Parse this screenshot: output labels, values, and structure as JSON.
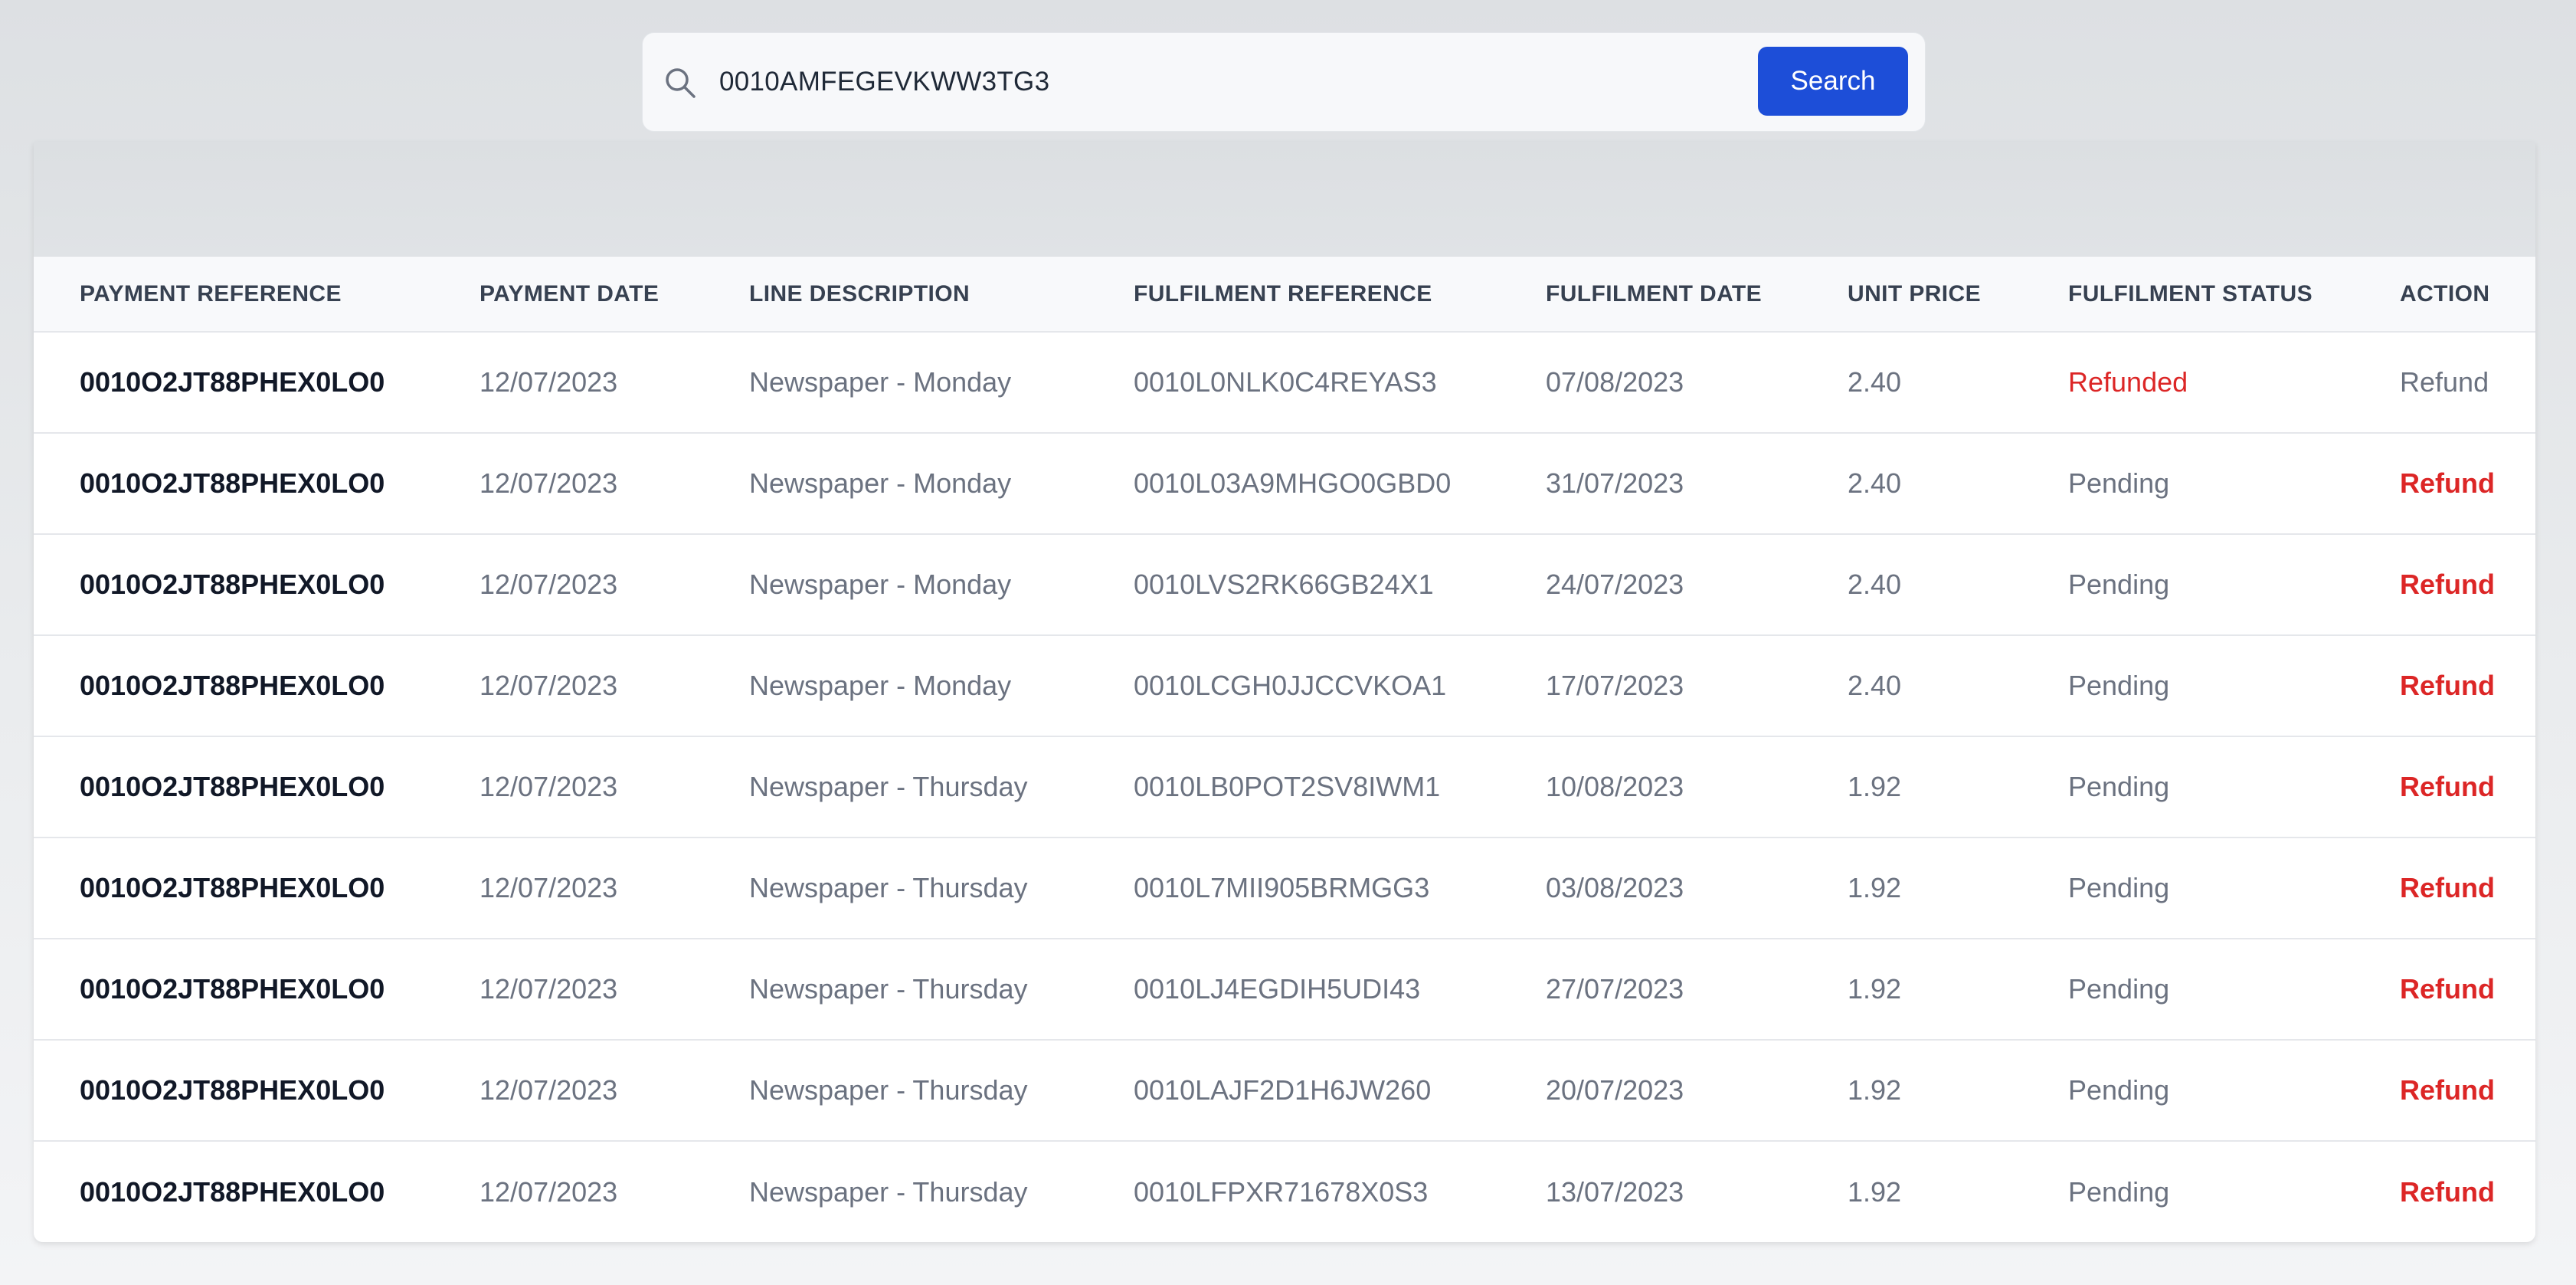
{
  "search": {
    "value": "0010AMFEGEVKWW3TG3",
    "button_label": "Search",
    "icon": "search-icon"
  },
  "table": {
    "headers": [
      "PAYMENT REFERENCE",
      "PAYMENT DATE",
      "LINE DESCRIPTION",
      "FULFILMENT REFERENCE",
      "FULFILMENT DATE",
      "UNIT PRICE",
      "FULFILMENT STATUS",
      "ACTION"
    ],
    "rows": [
      {
        "payment_reference": "0010O2JT88PHEX0LO0",
        "payment_date": "12/07/2023",
        "line_description": "Newspaper - Monday",
        "fulfilment_reference": "0010L0NLK0C4REYAS3",
        "fulfilment_date": "07/08/2023",
        "unit_price": "2.40",
        "fulfilment_status": "Refunded",
        "action": "Refund",
        "action_enabled": false
      },
      {
        "payment_reference": "0010O2JT88PHEX0LO0",
        "payment_date": "12/07/2023",
        "line_description": "Newspaper - Monday",
        "fulfilment_reference": "0010L03A9MHGO0GBD0",
        "fulfilment_date": "31/07/2023",
        "unit_price": "2.40",
        "fulfilment_status": "Pending",
        "action": "Refund",
        "action_enabled": true
      },
      {
        "payment_reference": "0010O2JT88PHEX0LO0",
        "payment_date": "12/07/2023",
        "line_description": "Newspaper - Monday",
        "fulfilment_reference": "0010LVS2RK66GB24X1",
        "fulfilment_date": "24/07/2023",
        "unit_price": "2.40",
        "fulfilment_status": "Pending",
        "action": "Refund",
        "action_enabled": true
      },
      {
        "payment_reference": "0010O2JT88PHEX0LO0",
        "payment_date": "12/07/2023",
        "line_description": "Newspaper - Monday",
        "fulfilment_reference": "0010LCGH0JJCCVKOA1",
        "fulfilment_date": "17/07/2023",
        "unit_price": "2.40",
        "fulfilment_status": "Pending",
        "action": "Refund",
        "action_enabled": true
      },
      {
        "payment_reference": "0010O2JT88PHEX0LO0",
        "payment_date": "12/07/2023",
        "line_description": "Newspaper - Thursday",
        "fulfilment_reference": "0010LB0POT2SV8IWM1",
        "fulfilment_date": "10/08/2023",
        "unit_price": "1.92",
        "fulfilment_status": "Pending",
        "action": "Refund",
        "action_enabled": true
      },
      {
        "payment_reference": "0010O2JT88PHEX0LO0",
        "payment_date": "12/07/2023",
        "line_description": "Newspaper - Thursday",
        "fulfilment_reference": "0010L7MII905BRMGG3",
        "fulfilment_date": "03/08/2023",
        "unit_price": "1.92",
        "fulfilment_status": "Pending",
        "action": "Refund",
        "action_enabled": true
      },
      {
        "payment_reference": "0010O2JT88PHEX0LO0",
        "payment_date": "12/07/2023",
        "line_description": "Newspaper - Thursday",
        "fulfilment_reference": "0010LJ4EGDIH5UDI43",
        "fulfilment_date": "27/07/2023",
        "unit_price": "1.92",
        "fulfilment_status": "Pending",
        "action": "Refund",
        "action_enabled": true
      },
      {
        "payment_reference": "0010O2JT88PHEX0LO0",
        "payment_date": "12/07/2023",
        "line_description": "Newspaper - Thursday",
        "fulfilment_reference": "0010LAJF2D1H6JW260",
        "fulfilment_date": "20/07/2023",
        "unit_price": "1.92",
        "fulfilment_status": "Pending",
        "action": "Refund",
        "action_enabled": true
      },
      {
        "payment_reference": "0010O2JT88PHEX0LO0",
        "payment_date": "12/07/2023",
        "line_description": "Newspaper - Thursday",
        "fulfilment_reference": "0010LFPXR71678X0S3",
        "fulfilment_date": "13/07/2023",
        "unit_price": "1.92",
        "fulfilment_status": "Pending",
        "action": "Refund",
        "action_enabled": true
      }
    ]
  },
  "colors": {
    "primary": "#1d4ed8",
    "danger": "#dc2626",
    "muted_text": "#6b7280",
    "strong_text": "#111827"
  }
}
